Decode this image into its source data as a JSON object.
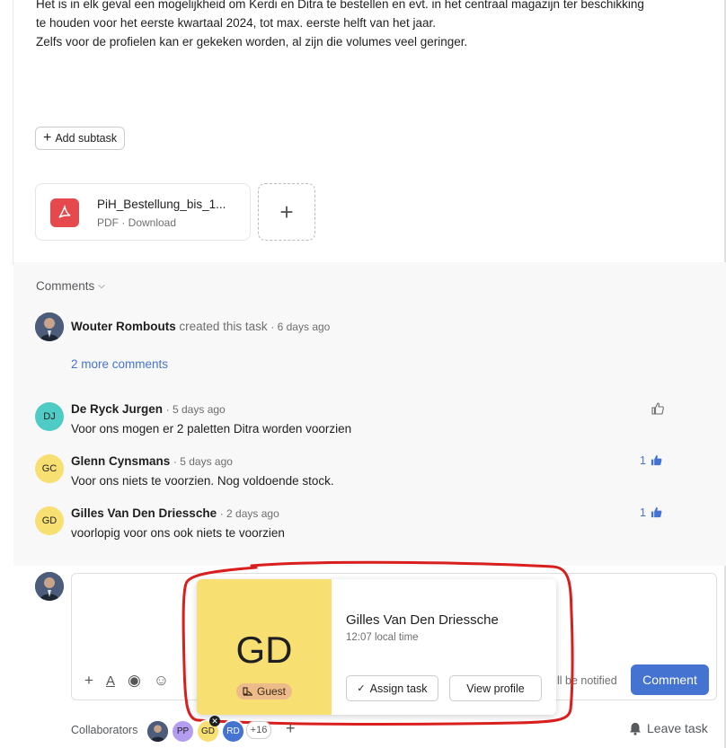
{
  "description": {
    "lines": [
      "Het is in elk geval een mogelijkheid om Kerdi en Ditra te bestellen en evt. in het centraal magazijn ter beschikking",
      "te houden voor het eerste kwartaal 2024, tot max. eerste helft van het jaar.",
      "Zelfs voor de profielen kan er gekeken worden, al zijn die volumes veel geringer."
    ]
  },
  "add_subtask_label": "Add subtask",
  "attachment": {
    "name": "PiH_Bestellung_bis_1...",
    "meta": "PDF · Download",
    "icon": "pdf-icon"
  },
  "comments_section": {
    "header": "Comments",
    "created": {
      "author": "Wouter Rombouts",
      "action": "created this task",
      "time": "· 6 days ago"
    },
    "more_comments": "2 more comments",
    "items": [
      {
        "initials": "DJ",
        "author": "De Ryck Jurgen",
        "time": "· 5 days ago",
        "text": "Voor ons mogen er 2 paletten Ditra worden voorzien",
        "likes": "",
        "color": "#4ecbc4"
      },
      {
        "initials": "GC",
        "author": "Glenn Cynsmans",
        "time": "· 5 days ago",
        "text": "Voor ons niets te voorzien. Nog voldoende stock.",
        "likes": "1",
        "color": "#f8df72"
      },
      {
        "initials": "GD",
        "author": "Gilles Van Den Driessche",
        "time": "· 2 days ago",
        "text": "voorlopig voor ons ook niets te voorzien",
        "likes": "1",
        "color": "#f8df72"
      }
    ]
  },
  "composer": {
    "notified_text": "ll be notified",
    "comment_button": "Comment"
  },
  "profile_card": {
    "initials": "GD",
    "guest_label": "Guest",
    "name": "Gilles Van Den Driessche",
    "local_time": "12:07 local time",
    "assign_label": "Assign task",
    "view_profile_label": "View profile"
  },
  "collaborators": {
    "label": "Collaborators",
    "avatars": [
      {
        "initials": "",
        "color": "#3a4a66"
      },
      {
        "initials": "PP",
        "color": "#b49cf0"
      },
      {
        "initials": "GD",
        "color": "#f8df72"
      },
      {
        "initials": "RD",
        "color": "#4573d2"
      }
    ],
    "more": "+16",
    "leave_label": "Leave task"
  },
  "colors": {
    "accent": "#4573d2",
    "annotation": "#d91e1e"
  }
}
